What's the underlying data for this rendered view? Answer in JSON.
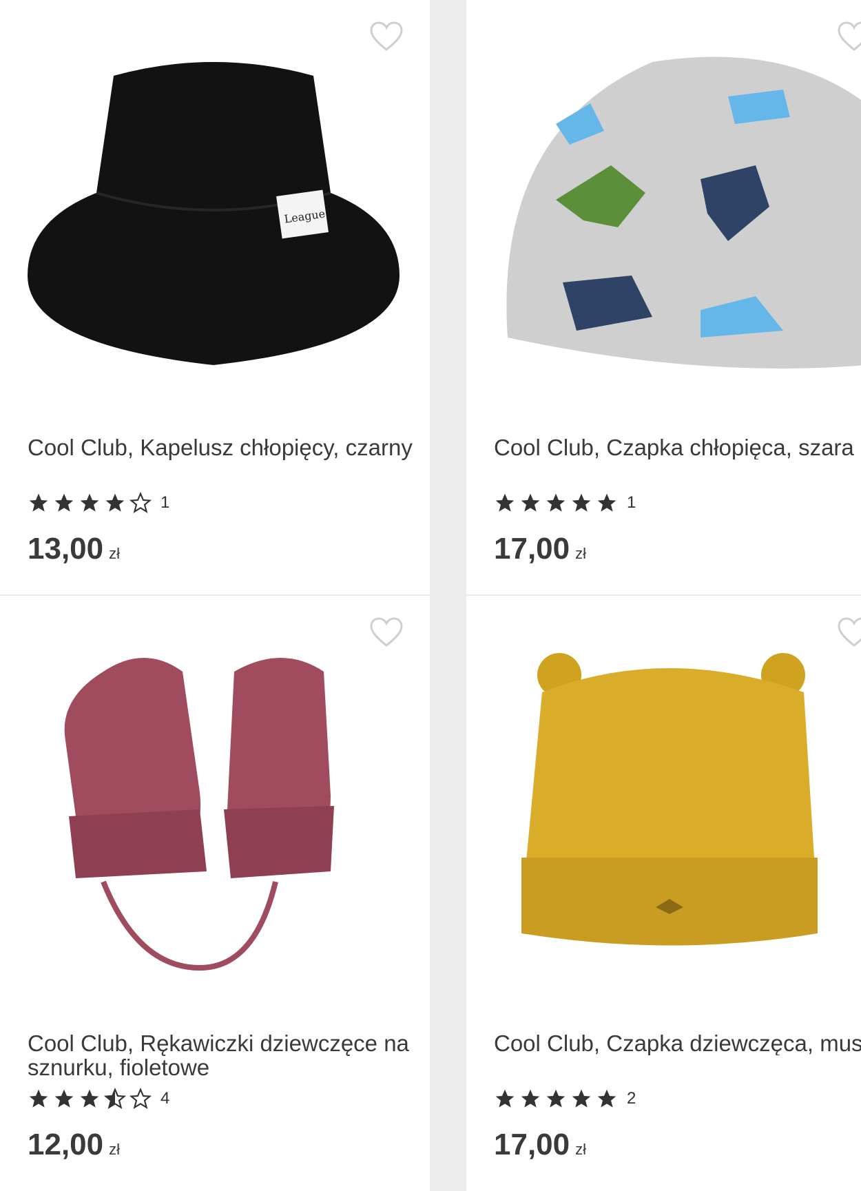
{
  "products": [
    {
      "title": "Cool Club, Kapelusz chłopięcy, czarny",
      "rating_stars": 4,
      "rating_count": "1",
      "price": "13,00",
      "currency": "zł",
      "image_icon": "black-bucket-hat-image",
      "image_label": "League"
    },
    {
      "title": "Cool Club, Czapka chłopięca, szara",
      "rating_stars": 5,
      "rating_count": "1",
      "price": "17,00",
      "currency": "zł",
      "image_icon": "grey-dinosaur-beanie-image"
    },
    {
      "title": "Cool Club, Rękawiczki dziewczęce na sznurku, fioletowe",
      "rating_stars": 3.5,
      "rating_count": "4",
      "price": "12,00",
      "currency": "zł",
      "image_icon": "pink-mittens-image"
    },
    {
      "title": "Cool Club, Czapka dziewczęca, musztardowa",
      "rating_stars": 5,
      "rating_count": "2",
      "price": "17,00",
      "currency": "zł",
      "image_icon": "mustard-cat-beanie-image"
    }
  ],
  "colors": {
    "text": "#3a3a3a",
    "star": "#333333",
    "heart_outline": "#cfcfcf",
    "background": "#ececec"
  }
}
